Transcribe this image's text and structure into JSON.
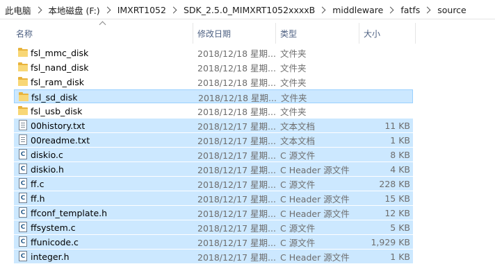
{
  "breadcrumb": [
    "此电脑",
    "本地磁盘 (F:)",
    "IMXRT1052",
    "SDK_2.5.0_MIMXRT1052xxxxB",
    "middleware",
    "fatfs",
    "source"
  ],
  "columns": {
    "name": "名称",
    "date": "修改日期",
    "type": "类型",
    "size": "大小"
  },
  "rows": [
    {
      "name": "fsl_mmc_disk",
      "date": "2018/12/18 星期...",
      "type": "文件夹",
      "size": "",
      "icon": "folder-icon"
    },
    {
      "name": "fsl_nand_disk",
      "date": "2018/12/18 星期...",
      "type": "文件夹",
      "size": "",
      "icon": "folder-icon"
    },
    {
      "name": "fsl_ram_disk",
      "date": "2018/12/18 星期...",
      "type": "文件夹",
      "size": "",
      "icon": "folder-icon"
    },
    {
      "name": "fsl_sd_disk",
      "date": "2018/12/18 星期...",
      "type": "文件夹",
      "size": "",
      "icon": "folder-icon"
    },
    {
      "name": "fsl_usb_disk",
      "date": "2018/12/18 星期...",
      "type": "文件夹",
      "size": "",
      "icon": "folder-icon"
    },
    {
      "name": "00history.txt",
      "date": "2018/12/17 星期...",
      "type": "文本文档",
      "size": "11 KB",
      "icon": "text-file-icon"
    },
    {
      "name": "00readme.txt",
      "date": "2018/12/17 星期...",
      "type": "文本文档",
      "size": "1 KB",
      "icon": "text-file-icon"
    },
    {
      "name": "diskio.c",
      "date": "2018/12/17 星期...",
      "type": "C 源文件",
      "size": "8 KB",
      "icon": "c-file-icon"
    },
    {
      "name": "diskio.h",
      "date": "2018/12/17 星期...",
      "type": "C Header 源文件",
      "size": "4 KB",
      "icon": "c-file-icon"
    },
    {
      "name": "ff.c",
      "date": "2018/12/17 星期...",
      "type": "C 源文件",
      "size": "228 KB",
      "icon": "c-file-icon"
    },
    {
      "name": "ff.h",
      "date": "2018/12/17 星期...",
      "type": "C Header 源文件",
      "size": "15 KB",
      "icon": "c-file-icon"
    },
    {
      "name": "ffconf_template.h",
      "date": "2018/12/17 星期...",
      "type": "C Header 源文件",
      "size": "12 KB",
      "icon": "c-file-icon"
    },
    {
      "name": "ffsystem.c",
      "date": "2018/12/17 星期...",
      "type": "C 源文件",
      "size": "5 KB",
      "icon": "c-file-icon"
    },
    {
      "name": "ffunicode.c",
      "date": "2018/12/17 星期...",
      "type": "C 源文件",
      "size": "1,929 KB",
      "icon": "c-file-icon"
    },
    {
      "name": "integer.h",
      "date": "2018/12/17 星期...",
      "type": "C Header 源文件",
      "size": "1 KB",
      "icon": "c-file-icon"
    }
  ],
  "icon_glyphs": {
    "c-file-icon": "C"
  },
  "colors": {
    "selection": "#cce8ff",
    "focus_border": "#99d1ff",
    "header_text": "#4d6082",
    "folder": "#f8d776"
  }
}
